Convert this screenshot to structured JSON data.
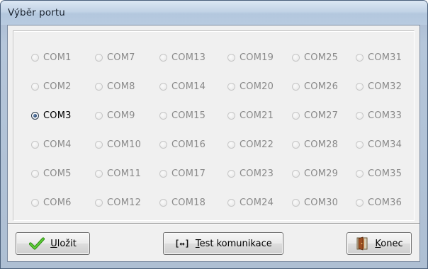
{
  "window": {
    "title": "Výběr portu"
  },
  "ports": {
    "selected": "COM3",
    "items": [
      {
        "label": "COM1",
        "checked": false
      },
      {
        "label": "COM2",
        "checked": false
      },
      {
        "label": "COM3",
        "checked": true
      },
      {
        "label": "COM4",
        "checked": false
      },
      {
        "label": "COM5",
        "checked": false
      },
      {
        "label": "COM6",
        "checked": false
      },
      {
        "label": "COM7",
        "checked": false
      },
      {
        "label": "COM8",
        "checked": false
      },
      {
        "label": "COM9",
        "checked": false
      },
      {
        "label": "COM10",
        "checked": false
      },
      {
        "label": "COM11",
        "checked": false
      },
      {
        "label": "COM12",
        "checked": false
      },
      {
        "label": "COM13",
        "checked": false
      },
      {
        "label": "COM14",
        "checked": false
      },
      {
        "label": "COM15",
        "checked": false
      },
      {
        "label": "COM16",
        "checked": false
      },
      {
        "label": "COM17",
        "checked": false
      },
      {
        "label": "COM18",
        "checked": false
      },
      {
        "label": "COM19",
        "checked": false
      },
      {
        "label": "COM20",
        "checked": false
      },
      {
        "label": "COM21",
        "checked": false
      },
      {
        "label": "COM22",
        "checked": false
      },
      {
        "label": "COM23",
        "checked": false
      },
      {
        "label": "COM24",
        "checked": false
      },
      {
        "label": "COM25",
        "checked": false
      },
      {
        "label": "COM26",
        "checked": false
      },
      {
        "label": "COM27",
        "checked": false
      },
      {
        "label": "COM28",
        "checked": false
      },
      {
        "label": "COM29",
        "checked": false
      },
      {
        "label": "COM30",
        "checked": false
      },
      {
        "label": "COM31",
        "checked": false
      },
      {
        "label": "COM32",
        "checked": false
      },
      {
        "label": "COM33",
        "checked": false
      },
      {
        "label": "COM34",
        "checked": false
      },
      {
        "label": "COM35",
        "checked": false
      },
      {
        "label": "COM36",
        "checked": false
      }
    ]
  },
  "buttons": {
    "save": {
      "mnemonic": "U",
      "rest": "ložit",
      "icon": "check-icon"
    },
    "test": {
      "prefix": "[↔]",
      "mnemonic": "T",
      "rest": "est komunikace",
      "icon": "arrows-icon"
    },
    "end": {
      "mnemonic": "K",
      "rest": "onec",
      "icon": "door-icon"
    }
  },
  "colors": {
    "title_bar": "#c2d3e6",
    "client_bg": "#f0f0f0",
    "disabled_text": "#8a8a8a",
    "check_green": "#3aa019",
    "door_brown": "#8b4a2a"
  }
}
